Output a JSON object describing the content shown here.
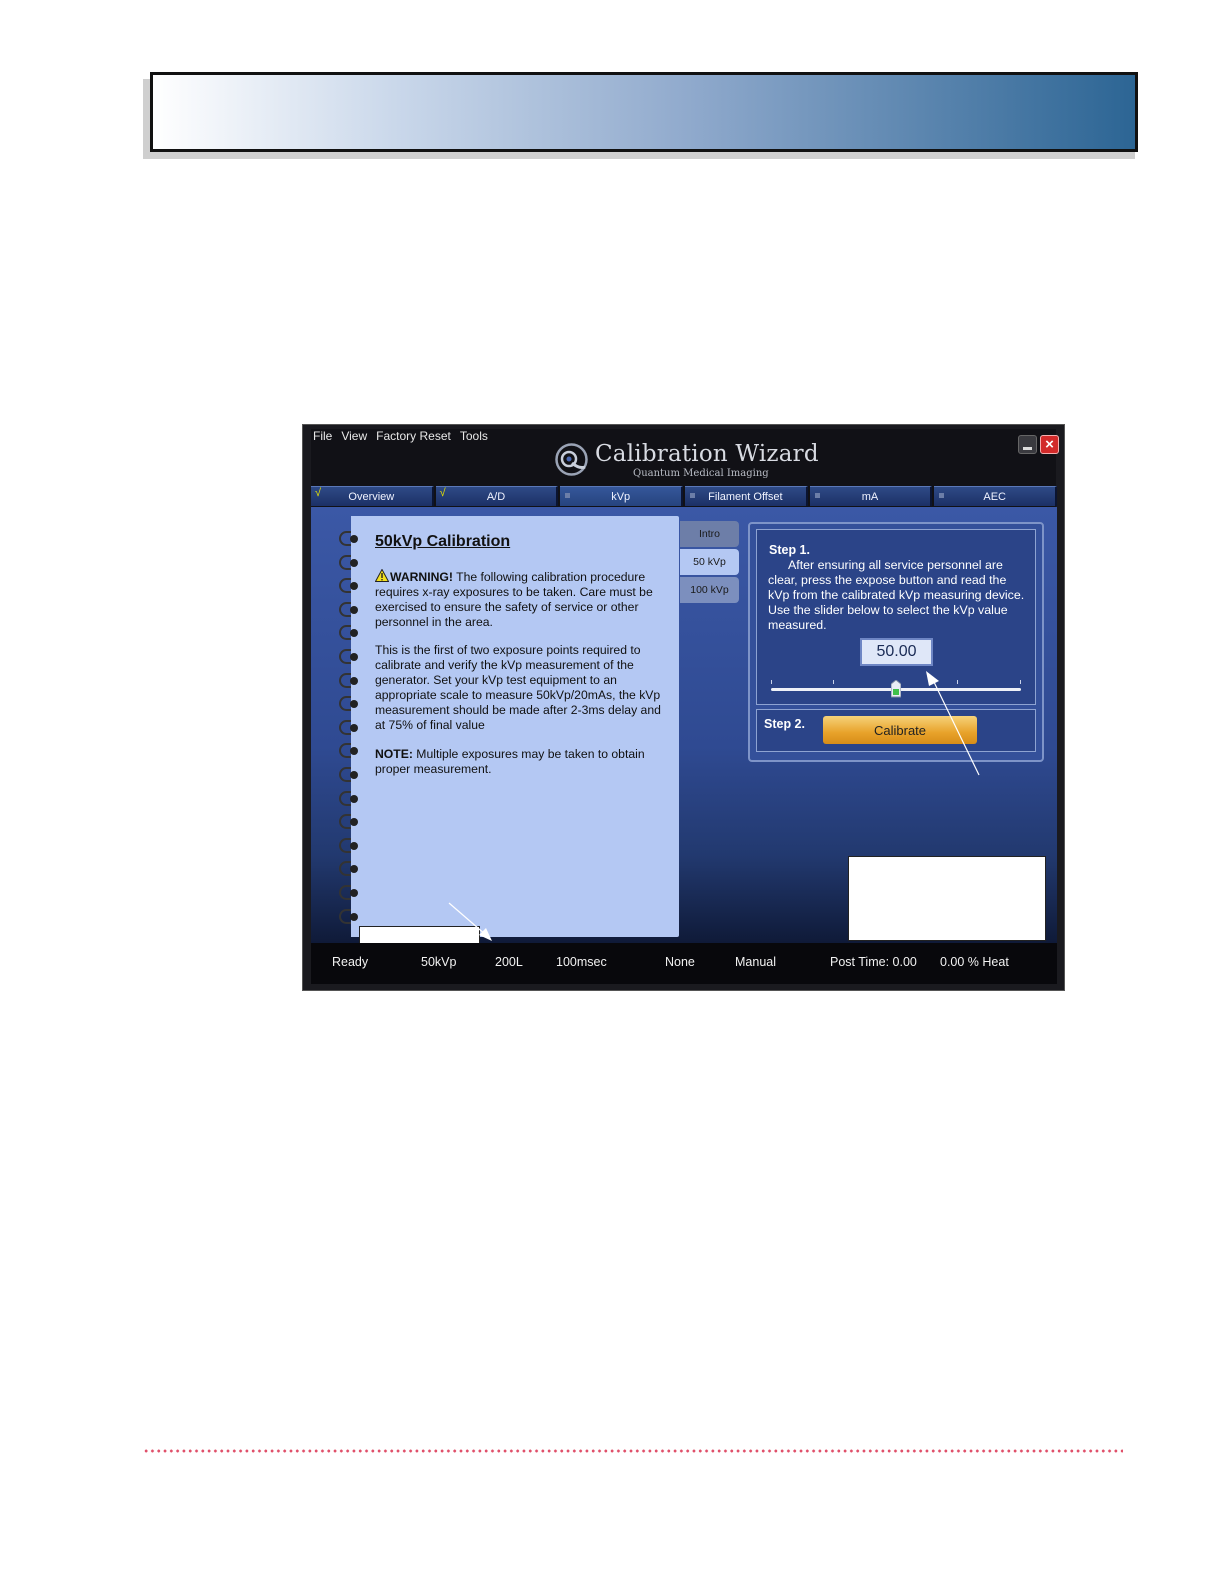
{
  "menu": [
    "File",
    "View",
    "Factory Reset",
    "Tools"
  ],
  "app": {
    "title": "Calibration Wizard",
    "subtitle": "Quantum Medical Imaging"
  },
  "tabs": [
    {
      "label": "Overview",
      "state": "done"
    },
    {
      "label": "A/D",
      "state": "done"
    },
    {
      "label": "kVp",
      "state": "active"
    },
    {
      "label": "Filament Offset",
      "state": "pending"
    },
    {
      "label": "mA",
      "state": "pending"
    },
    {
      "label": "AEC",
      "state": "pending"
    }
  ],
  "tab_check_glyph": "√",
  "notebook": {
    "title": "50kVp Calibration",
    "warning_label": "WARNING!",
    "warning_text": " The following calibration procedure requires x-ray exposures to be taken.  Care must be exercised to ensure the safety of service or other personnel in the area.",
    "paragraph": "This is the first of two exposure points required to calibrate and verify the kVp measurement of the generator.  Set your kVp test equipment to an appropriate scale to measure 50kVp/20mAs, the kVp measurement should be made after 2-3ms delay and at 75% of final value",
    "note_label": "NOTE:",
    "note_text": " Multiple exposures may be taken to obtain proper measurement."
  },
  "side_tabs": [
    "Intro",
    "50 kVp",
    "100 kVp"
  ],
  "step1": {
    "title": "Step 1.",
    "text": "After ensuring all service personnel are clear, press the expose button and read the kVp from the calibrated kVp measuring device. Use the slider below to select the kVp value measured.",
    "value": "50.00",
    "slider_fraction": 0.5
  },
  "step2": {
    "title": "Step 2.",
    "button": "Calibrate"
  },
  "status": {
    "state": "Ready",
    "kvp": "50kVp",
    "focus": "200L",
    "time": "100msec",
    "mode1": "None",
    "mode2": "Manual",
    "post_time": "Post Time: 0.00",
    "heat": "0.00 % Heat"
  },
  "colors": {
    "banner_end": "#2c6594",
    "content_blue": "#3b58a6",
    "notebook_bg": "#b4c8f3",
    "calibrate_orange": "#e8a22a",
    "close_red": "#d22a2a",
    "footer_dots": "#e0506a"
  },
  "icons": [
    "app-logo-icon",
    "minimize-icon",
    "close-icon",
    "warning-icon",
    "slider-thumb-icon"
  ]
}
